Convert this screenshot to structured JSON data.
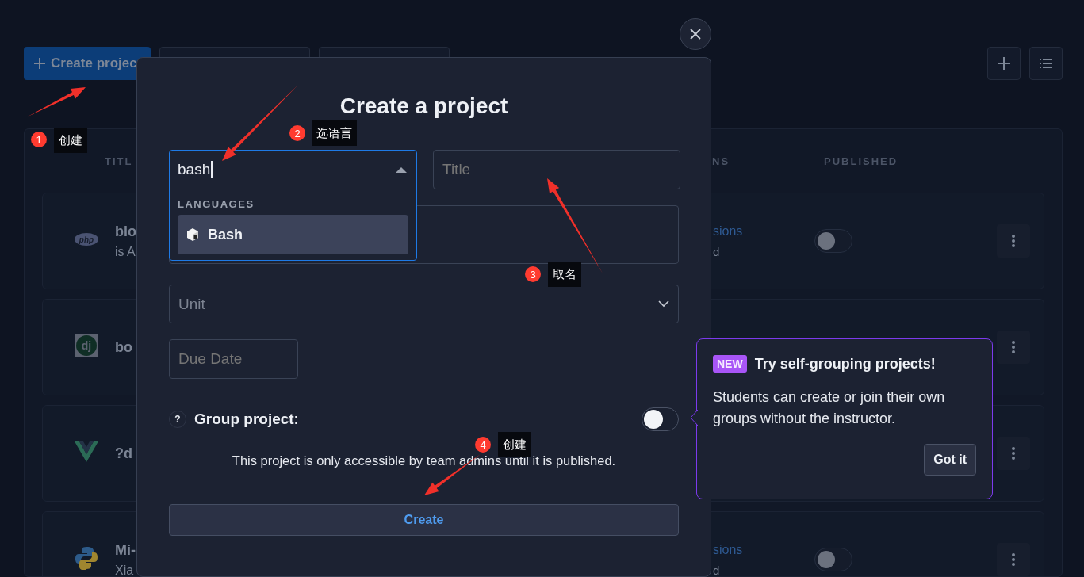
{
  "toolbar": {
    "create_button": "Create projec"
  },
  "table": {
    "columns": [
      "TITL",
      "NS",
      "PUBLISHED"
    ],
    "rows": [
      {
        "kind": "php",
        "logo_text": "php",
        "title": "blo",
        "subtitle": "is A",
        "submissions": "sions",
        "status": "d",
        "published": false
      },
      {
        "kind": "django",
        "logo_text": "dj",
        "title": "bo"
      },
      {
        "kind": "vue",
        "title": "?d"
      },
      {
        "kind": "python",
        "title": "Mi-",
        "subtitle": "Xia",
        "submissions": "sions",
        "status": "d",
        "published": false
      }
    ]
  },
  "modal": {
    "title": "Create a project",
    "language": {
      "value": "bash",
      "open": true,
      "group": "LANGUAGES",
      "options": [
        {
          "label": "Bash",
          "selected": true
        }
      ]
    },
    "title_field": {
      "placeholder": "Title"
    },
    "unit": {
      "placeholder": "Unit"
    },
    "due_date": {
      "placeholder": "Due Date"
    },
    "group_project": {
      "help": "?",
      "label": "Group project:",
      "on": false
    },
    "notice": "This project is only accessible by team admins until it is published.",
    "create_button": "Create"
  },
  "tooltip": {
    "badge": "NEW",
    "title": "Try self-grouping projects!",
    "body": "Students can create or join their own groups without the instructor.",
    "button": "Got it"
  },
  "annotations": [
    {
      "number": "1",
      "label": "创建"
    },
    {
      "number": "2",
      "label": "选语言"
    },
    {
      "number": "3",
      "label": "取名"
    },
    {
      "number": "4",
      "label": "创建"
    }
  ]
}
